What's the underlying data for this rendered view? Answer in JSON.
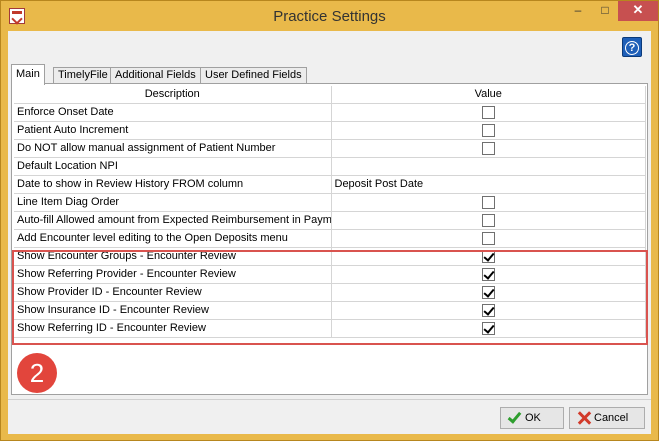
{
  "window": {
    "title": "Practice Settings",
    "minimize": "–",
    "maximize": "□",
    "close": "✕"
  },
  "help": {
    "label": "?"
  },
  "tabs": [
    {
      "label": "Main",
      "active": true
    },
    {
      "label": "TimelyFile"
    },
    {
      "label": "Additional Fields"
    },
    {
      "label": "User Defined Fields"
    }
  ],
  "grid": {
    "headers": {
      "description": "Description",
      "value": "Value"
    },
    "rows": [
      {
        "description": "Enforce Onset Date",
        "type": "checkbox",
        "checked": false
      },
      {
        "description": "Patient Auto Increment",
        "type": "checkbox",
        "checked": false
      },
      {
        "description": "Do NOT allow manual assignment of Patient Number",
        "type": "checkbox",
        "checked": false
      },
      {
        "description": "Default Location NPI",
        "type": "text",
        "value": ""
      },
      {
        "description": "Date to show in Review History FROM column",
        "type": "text",
        "value": "Deposit Post Date"
      },
      {
        "description": "Line Item Diag Order",
        "type": "checkbox",
        "checked": false
      },
      {
        "description": "Auto-fill Allowed amount from Expected Reimbursement in Payme",
        "type": "checkbox",
        "checked": false
      },
      {
        "description": "Add Encounter level editing to the Open Deposits menu",
        "type": "checkbox",
        "checked": false
      },
      {
        "description": "Show Encounter Groups - Encounter Review",
        "type": "checkbox",
        "checked": true
      },
      {
        "description": "Show Referring Provider - Encounter Review",
        "type": "checkbox",
        "checked": true
      },
      {
        "description": "Show Provider ID - Encounter Review",
        "type": "checkbox",
        "checked": true
      },
      {
        "description": "Show Insurance ID - Encounter Review",
        "type": "checkbox",
        "checked": true
      },
      {
        "description": "Show Referring ID - Encounter Review",
        "type": "checkbox",
        "checked": true
      }
    ]
  },
  "annotation": {
    "step": "2",
    "color": "#e2453c"
  },
  "buttons": {
    "ok": "OK",
    "cancel": "Cancel"
  }
}
